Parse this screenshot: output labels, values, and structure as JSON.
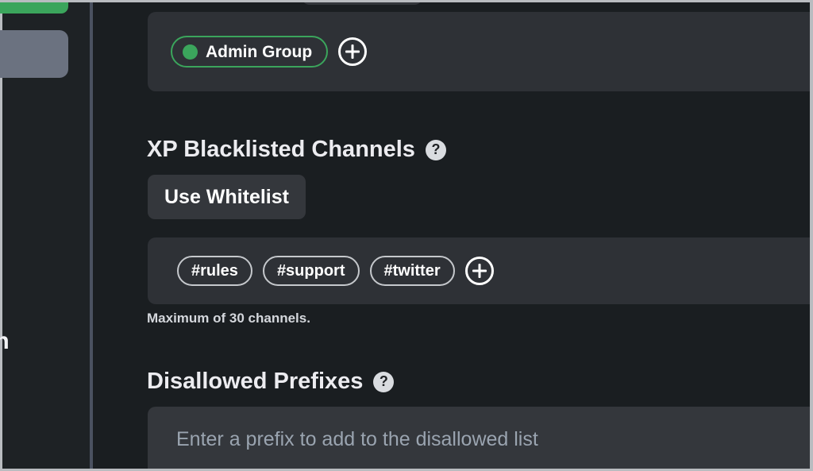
{
  "sidebar": {
    "items": [
      {
        "name": "green-nav-item",
        "label": ""
      },
      {
        "name": "selected-nav-item",
        "label": ""
      }
    ],
    "clipped_label": "wn"
  },
  "groups_panel": {
    "tags": [
      {
        "label": "Admin Group",
        "dot_color": "#3ba55c",
        "border_color": "#3ba55c"
      }
    ],
    "add_label": "+"
  },
  "xp_blacklist": {
    "heading": "XP Blacklisted Channels",
    "help": "?",
    "toggle_button": "Use Whitelist",
    "channels": [
      {
        "label": "#rules"
      },
      {
        "label": "#support"
      },
      {
        "label": "#twitter"
      }
    ],
    "add_label": "+",
    "hint": "Maximum of 30 channels."
  },
  "disallowed_prefixes": {
    "heading": "Disallowed Prefixes",
    "help": "?",
    "input_value": "",
    "input_placeholder": "Enter a prefix to add to the disallowed list"
  },
  "colors": {
    "background": "#1a1e21",
    "panel": "#2e3136",
    "button": "#34373c",
    "accent_green": "#3ba55c",
    "selected_gray": "#6b7280",
    "divider": "#4a5160",
    "text_primary": "#ffffff",
    "text_muted": "#9aa4b0"
  }
}
